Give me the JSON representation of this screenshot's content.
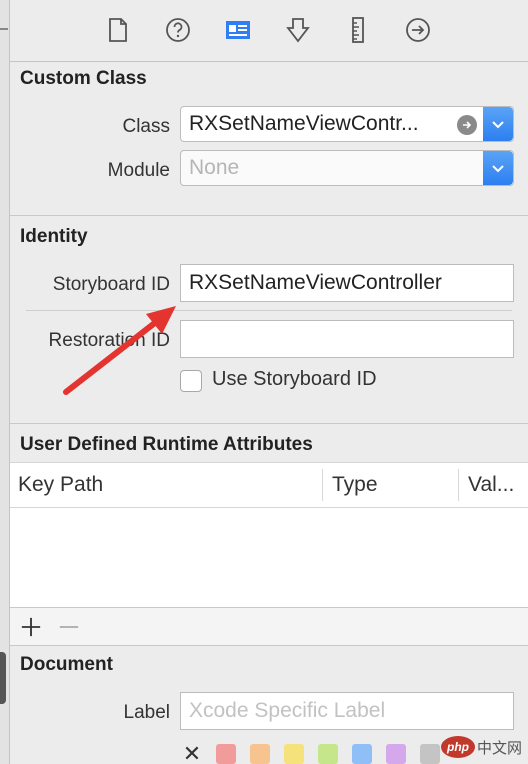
{
  "toolbar": {
    "icons": [
      "file-inspector-icon",
      "quick-help-icon",
      "identity-inspector-icon",
      "attributes-inspector-icon",
      "size-inspector-icon",
      "connections-inspector-icon"
    ],
    "selected": "identity-inspector-icon",
    "accent": "#2f7ef3"
  },
  "custom_class": {
    "title": "Custom Class",
    "class_label": "Class",
    "class_value": "RXSetNameViewContr...",
    "module_label": "Module",
    "module_value": "None"
  },
  "identity": {
    "title": "Identity",
    "storyboard_id_label": "Storyboard ID",
    "storyboard_id_value": "RXSetNameViewController",
    "restoration_id_label": "Restoration ID",
    "restoration_id_value": "",
    "use_storyboard_id_label": "Use Storyboard ID",
    "use_storyboard_id_checked": false
  },
  "runtime_attributes": {
    "title": "User Defined Runtime Attributes",
    "columns": [
      "Key Path",
      "Type",
      "Val..."
    ],
    "rows": [],
    "add_symbol": "+",
    "remove_symbol": "−"
  },
  "document": {
    "title": "Document",
    "label_label": "Label",
    "label_placeholder": "Xcode Specific Label",
    "clear_symbol": "✕",
    "colors": [
      "#f29b9b",
      "#f7c48f",
      "#f6e27a",
      "#c6e68a",
      "#8fbff6",
      "#d5a8ec",
      "#c4c4c4"
    ]
  },
  "watermark": {
    "logo": "php",
    "text": "中文网"
  },
  "annotation": {
    "arrow_color": "#e3342f"
  }
}
